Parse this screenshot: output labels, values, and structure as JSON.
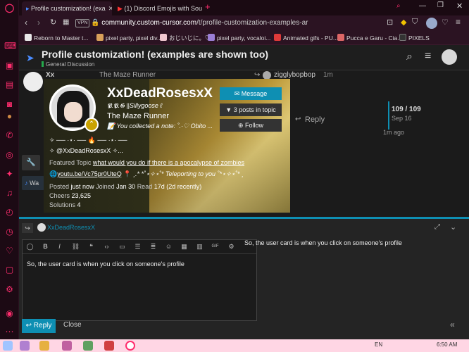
{
  "tabs": [
    {
      "title": "Profile customization! (exa",
      "close": "✕"
    },
    {
      "title": "(1) Discord Emojis with Sou",
      "close": "✕"
    }
  ],
  "new_tab": "+",
  "address": {
    "vpn": "VPN",
    "url_domain": "community.custom-cursor.com",
    "url_path": "/t/profile-customization-examples-ar"
  },
  "bookmarks": [
    {
      "label": "Reborn to Master t...",
      "color": "#e9e9e9"
    },
    {
      "label": "pixel party, pixel div...",
      "color": "#d9a15a"
    },
    {
      "label": "おじいじに。♡",
      "color": "#f0c8d0"
    },
    {
      "label": "pixel party, vocaloi...",
      "color": "#9b7fd6"
    },
    {
      "label": "Animated gifs - PU...",
      "color": "#e03a3a"
    },
    {
      "label": "Pucca e Garu - Cia...",
      "color": "#d66"
    },
    {
      "label": "PIXELS",
      "color": "#333"
    }
  ],
  "topic": {
    "title": "Profile customization! (examples are shown too)",
    "category": "General Discussion"
  },
  "post": {
    "username_short": "Xx",
    "title_text": "The Maze Runner",
    "reply_to": "zigglybopbop",
    "time": "1m",
    "reply_label": "Reply",
    "progress": "109 / 109",
    "progress_date": "Sep 16",
    "ago": "1m ago",
    "side_label": "Wa"
  },
  "card": {
    "name": "XxDeadRosesxX",
    "username": "𝕻.𝕻.𝕲 ||Sillygoose ℓ",
    "user_title": "The Maze Runner",
    "note": "📝 You collected a note: ˚.·♡ Obito ...",
    "message_btn": "Message",
    "posts_btn": "3 posts in topic",
    "follow_btn": "Follow",
    "flair": "✧ ── ·⋆· ── 🔥 ── ·⋆· ──",
    "handle": "✧ @XxDeadRosesxX ✧...",
    "featured_label": "Featured Topic",
    "featured_link": "what would you do if there is a apocalypse of zombies",
    "website": "youtu.be/Vc75pr0UteQ",
    "location": "¸.* *˚⋆✧⋆˚* Teleporting to you ˚*⋆✧⋆˚* ¸",
    "posted_label": "Posted",
    "posted": "just now",
    "joined_label": "Joined",
    "joined": "Jan 30",
    "read_label": "Read",
    "read": "17d (2d recently)",
    "cheers_label": "Cheers",
    "cheers": "23,625",
    "solutions_label": "Solutions",
    "solutions": "4"
  },
  "composer": {
    "reply_to_user": "XxDeadRosesxX",
    "text": "So, the user card is when you click on someone's profile",
    "preview": "So, the user card is when you click on someone's profile",
    "reply_btn": "Reply",
    "close_btn": "Close",
    "collapse": "«"
  },
  "taskbar": {
    "lang": "EN",
    "time": "6:50 AM"
  },
  "colors": {
    "accent": "#0e8fb3",
    "opera": "#ff2d6e"
  }
}
